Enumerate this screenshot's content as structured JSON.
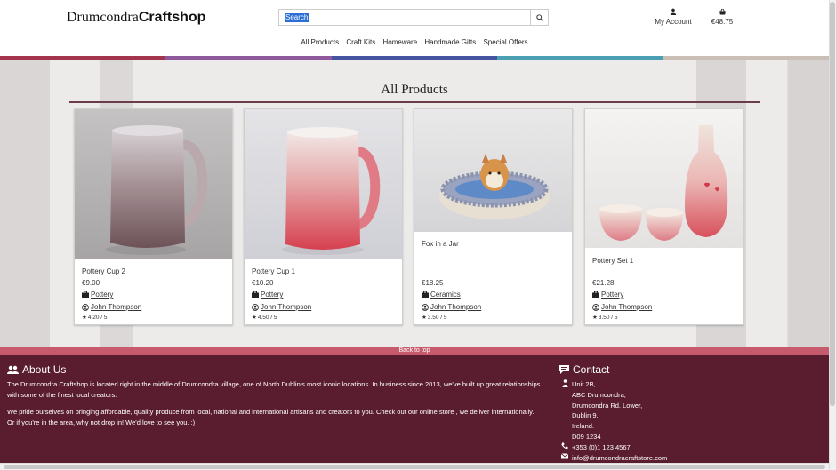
{
  "brand": {
    "part1": "Drumcondra",
    "part2": "Craftshop"
  },
  "search": {
    "placeholder": "Search",
    "value": "Search"
  },
  "account": {
    "label": "My Account"
  },
  "bag": {
    "total": "€48.75"
  },
  "nav": {
    "items": [
      "All Products",
      "Craft Kits",
      "Homeware",
      "Handmade Gifts",
      "Special Offers"
    ]
  },
  "stripe_colors": [
    "#a3344e",
    "#8e5a9c",
    "#46549f",
    "#4a9fb3",
    "#c9bfb6"
  ],
  "main": {
    "title": "All Products"
  },
  "products": [
    {
      "name": "Pottery Cup 2",
      "price": "€9.00",
      "category": "Pottery",
      "maker": "John Thompson",
      "rating": "4.20 / 5"
    },
    {
      "name": "Pottery Cup 1",
      "price": "€10.20",
      "category": "Pottery",
      "maker": "John Thompson",
      "rating": "4.50 / 5"
    },
    {
      "name": "Fox in a Jar",
      "price": "€18.25",
      "category": "Ceramics",
      "maker": "John Thompson",
      "rating": "3.50 / 5"
    },
    {
      "name": "Pottery Set 1",
      "price": "€21.28",
      "category": "Pottery",
      "maker": "John Thompson",
      "rating": "3.50 / 5"
    }
  ],
  "back_to_top": "Back to top",
  "footer": {
    "about_title": "About Us",
    "about_p1": "The Drumcondra Craftshop is located right in the middle of Drumcondra village, one of North Dublin's most iconic locations. In business since 2013, we've built up great relationships with some of the finest local creators.",
    "about_p2": "We pride ourselves on bringing affordable, quality produce from local, national and international artisans and creators to you. Check out our online store , we deliver internationally. Or if you're in the area, why not drop in! We'd love to see you. :)",
    "contact_title": "Contact",
    "address": [
      "Unit 2B,",
      "ABC Drumcondra,",
      "Drumcondra Rd. Lower,",
      "Dublin 9,",
      "Ireland.",
      "D09 1234"
    ],
    "phone": "+353 (0)1 123 4567",
    "email": "info@drumcondracraftstore.com"
  }
}
